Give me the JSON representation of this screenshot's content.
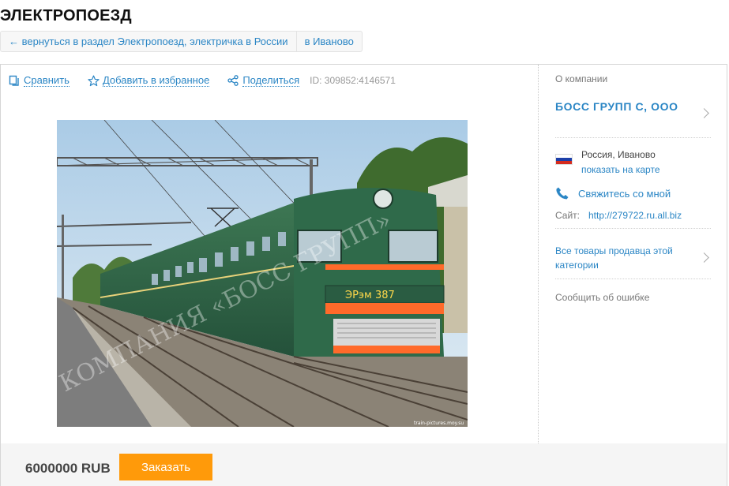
{
  "page": {
    "title": "ЭЛЕКТРОПОЕЗД"
  },
  "breadcrumb": {
    "back_label": "← вернуться в раздел Электропоезд, электричка в России",
    "city_label": "в Иваново"
  },
  "toolbar": {
    "compare_label": "Сравнить",
    "favorite_label": "Добавить в избранное",
    "share_label": "Поделиться",
    "id_text": "ID: 309852:4146571"
  },
  "photo": {
    "watermark": "КОМПАНИЯ «БОСС ГРУПП»",
    "train_number": "ЭРэм 387",
    "credit": "train-pictures.moy.su"
  },
  "purchase": {
    "price": "6000000 RUB",
    "order_label": "Заказать",
    "accent_color": "#ff9a0a"
  },
  "sidebar": {
    "heading": "О компании",
    "company_name": "БОСС ГРУПП С, ООО",
    "location": "Россия, Иваново",
    "map_link": "показать на карте",
    "contact_label": "Свяжитесь со мной",
    "site_label": "Сайт:",
    "site_url": "http://279722.ru.all.biz",
    "all_goods_label": "Все товары продавца этой категории",
    "report_label": "Сообщить об ошибке",
    "link_color": "#2b86c5"
  }
}
